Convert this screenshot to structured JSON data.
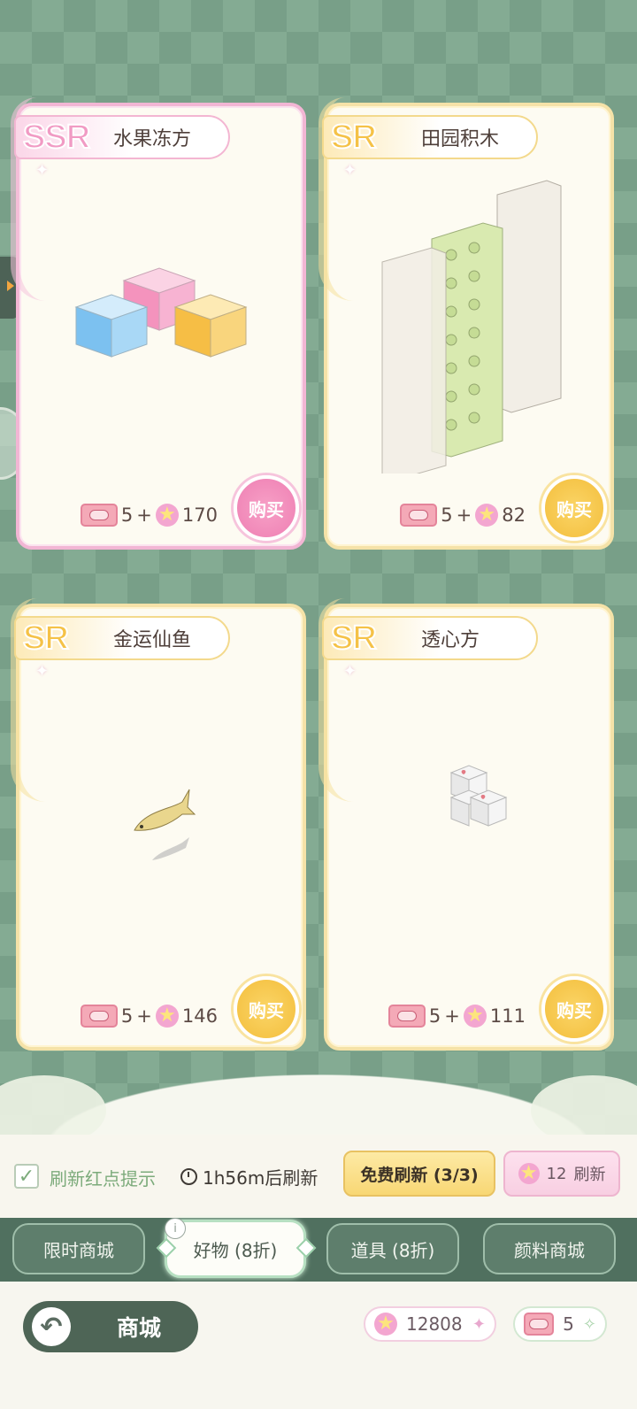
{
  "cards": [
    {
      "rarity": "SSR",
      "name": "水果冻方",
      "ticket": "5",
      "plus": "+",
      "gems": "170",
      "buy": "购买"
    },
    {
      "rarity": "SR",
      "name": "田园积木",
      "ticket": "5",
      "plus": "+",
      "gems": "82",
      "buy": "购买"
    },
    {
      "rarity": "SR",
      "name": "金运仙鱼",
      "ticket": "5",
      "plus": "+",
      "gems": "146",
      "buy": "购买"
    },
    {
      "rarity": "SR",
      "name": "透心方",
      "ticket": "5",
      "plus": "+",
      "gems": "111",
      "buy": "购买"
    }
  ],
  "refresh": {
    "checkbox_label": "刷新红点提示",
    "timer": "1h56m后刷新",
    "free_button": "免费刷新 (3/3)",
    "paid_count": "12",
    "paid_label": "刷新"
  },
  "tabs": [
    {
      "label": "限时商城"
    },
    {
      "label": "好物 (8折)"
    },
    {
      "label": "道具 (8折)"
    },
    {
      "label": "颜料商城"
    }
  ],
  "info_label": "i",
  "footer": {
    "title": "商城",
    "gems": "12808",
    "tickets": "5"
  },
  "colors": {
    "ssr_pink": "#f2b6d4",
    "sr_gold": "#f5e2a8",
    "tab_bar": "#50705f",
    "background": "#789f88"
  },
  "icons": [
    "back-arrow-icon",
    "clock-icon",
    "check-icon",
    "star-gem-icon",
    "ticket-icon",
    "info-icon"
  ]
}
